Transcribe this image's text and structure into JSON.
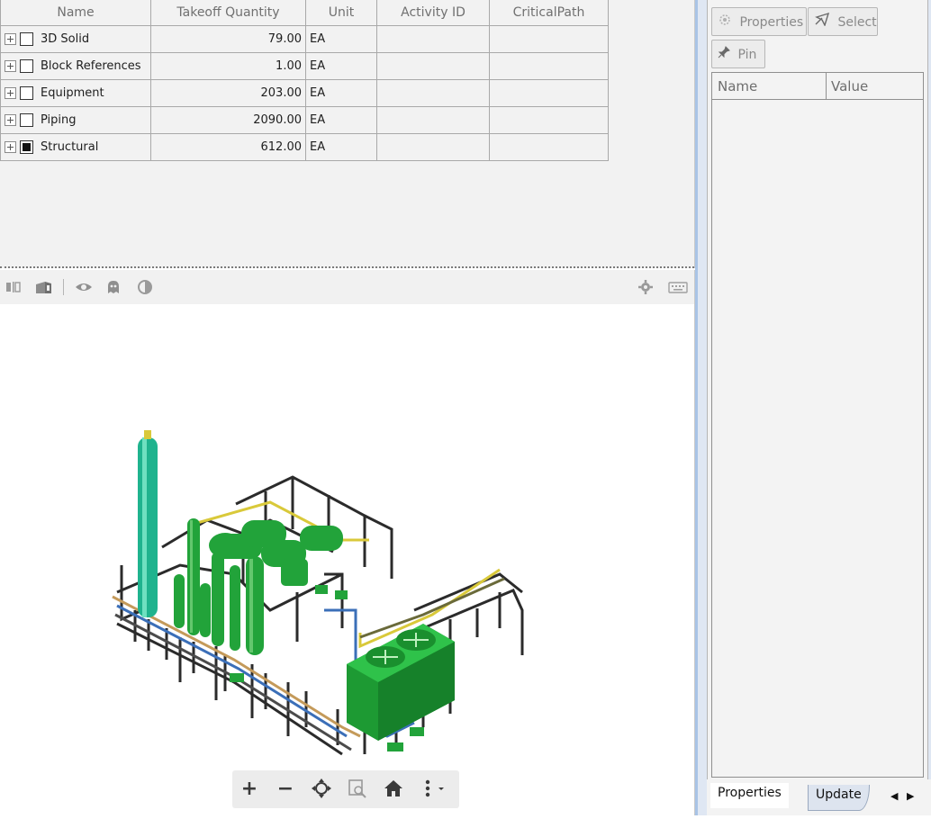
{
  "grid": {
    "columns": [
      "Name",
      "Takeoff Quantity",
      "Unit",
      "Activity ID",
      "CriticalPath"
    ],
    "rows": [
      {
        "name": "3D Solid",
        "quantity": "79.00",
        "unit": "EA",
        "activity_id": "",
        "critical_path": "",
        "checkbox": "unchecked"
      },
      {
        "name": "Block References",
        "quantity": "1.00",
        "unit": "EA",
        "activity_id": "",
        "critical_path": "",
        "checkbox": "unchecked"
      },
      {
        "name": "Equipment",
        "quantity": "203.00",
        "unit": "EA",
        "activity_id": "",
        "critical_path": "",
        "checkbox": "unchecked"
      },
      {
        "name": "Piping",
        "quantity": "2090.00",
        "unit": "EA",
        "activity_id": "",
        "critical_path": "",
        "checkbox": "unchecked"
      },
      {
        "name": "Structural",
        "quantity": "612.00",
        "unit": "EA",
        "activity_id": "",
        "critical_path": "",
        "checkbox": "partial"
      }
    ]
  },
  "viewer_toolbar": {
    "icons": [
      "section-icon",
      "box-icon",
      "eye-icon",
      "ghost-icon",
      "contrast-icon",
      "settings-icon",
      "keyboard-icon"
    ]
  },
  "nav_bar": {
    "icons": [
      "zoom-in-icon",
      "zoom-out-icon",
      "pan-icon",
      "zoom-window-icon",
      "home-icon",
      "more-icon"
    ]
  },
  "properties_panel": {
    "properties_button": "Properties",
    "select_button": "Select",
    "pin_button": "Pin",
    "name_header": "Name",
    "value_header": "Value"
  },
  "bottom_tabs": {
    "tabs": [
      "Properties",
      "Update"
    ],
    "active": "Properties"
  },
  "colors": {
    "equipment_green": "#22a33a",
    "tower_teal": "#1fb38e",
    "steel_dark": "#2b2b2b",
    "pipe_yellow": "#d9c93a",
    "pipe_blue": "#3b6fb8",
    "panel_blue": "#a9c4e6"
  }
}
